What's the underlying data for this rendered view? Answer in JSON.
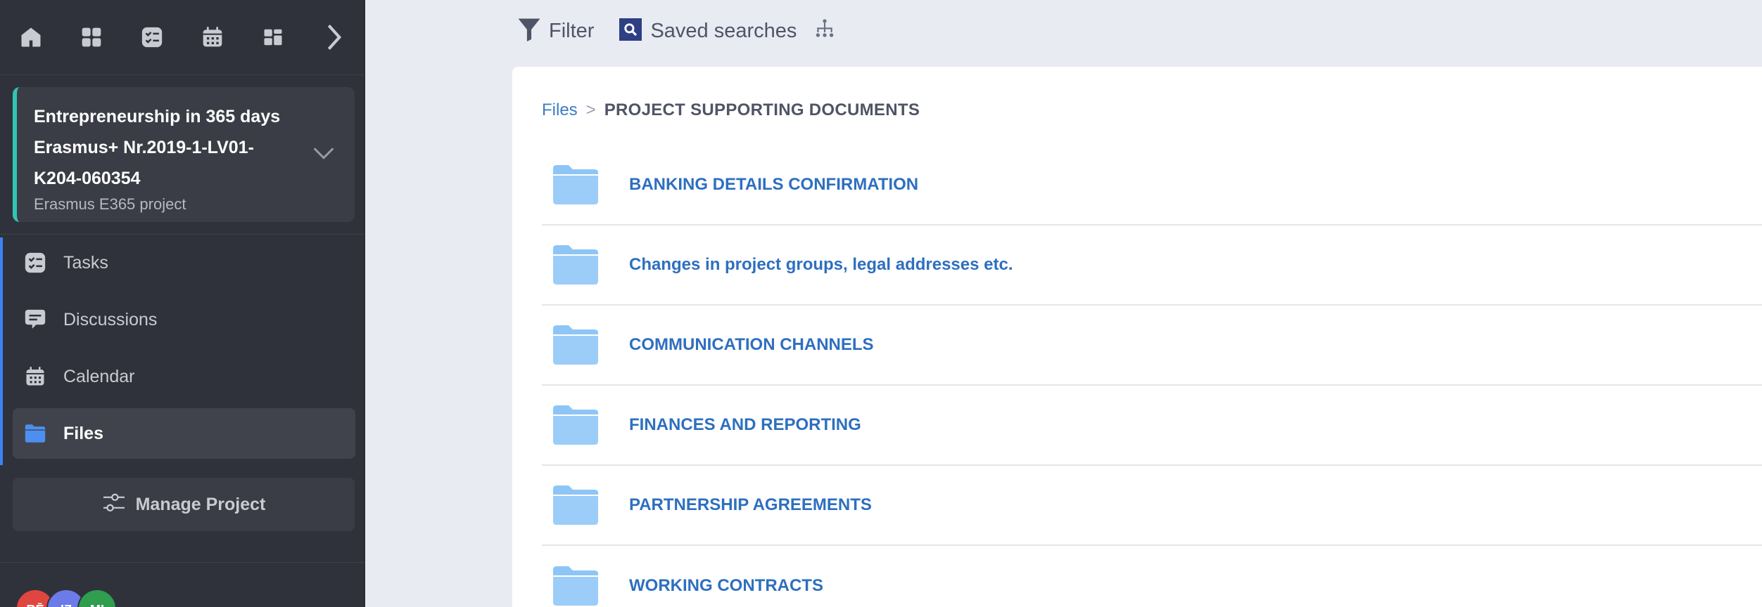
{
  "topnav": {
    "items": [
      {
        "icon": "home-icon"
      },
      {
        "icon": "dashboard-icon"
      },
      {
        "icon": "tasks-icon"
      },
      {
        "icon": "calendar-icon"
      },
      {
        "icon": "apps-icon"
      },
      {
        "icon": "chevron-right-icon"
      }
    ]
  },
  "project": {
    "title_line1": "Entrepreneurship in 365 days",
    "title_line2": "Erasmus+ Nr.2019-1-LV01-",
    "title_line3": "K204-060354",
    "subtitle": "Erasmus E365 project"
  },
  "sidebar": {
    "items": [
      {
        "label": "Tasks",
        "icon": "tasks-icon"
      },
      {
        "label": "Discussions",
        "icon": "chat-icon"
      },
      {
        "label": "Calendar",
        "icon": "calendar-icon"
      },
      {
        "label": "Files",
        "icon": "folder-icon",
        "active": true
      }
    ],
    "manage_label": "Manage Project"
  },
  "avatars": [
    {
      "initials": "RĒ",
      "color": "#e0463f"
    },
    {
      "initials": "IZ",
      "color": "#6c7be8"
    },
    {
      "initials": "MI",
      "color": "#2f9e4f"
    }
  ],
  "toolbar": {
    "filter_label": "Filter",
    "saved_label": "Saved searches"
  },
  "breadcrumb": {
    "root": "Files",
    "separator": ">",
    "current": "PROJECT SUPPORTING DOCUMENTS"
  },
  "folders": [
    "BANKING DETAILS CONFIRMATION",
    "Changes in project groups, legal addresses etc.",
    "COMMUNICATION CHANNELS",
    "FINANCES AND REPORTING",
    "PARTNERSHIP AGREEMENTS",
    "WORKING CONTRACTS"
  ],
  "colors": {
    "sidebar_bg": "#30323b",
    "accent_teal": "#34c3b4",
    "accent_blue": "#3b82f6",
    "link_blue": "#2e6fbf",
    "folder_blue": "#8ec5f7"
  }
}
